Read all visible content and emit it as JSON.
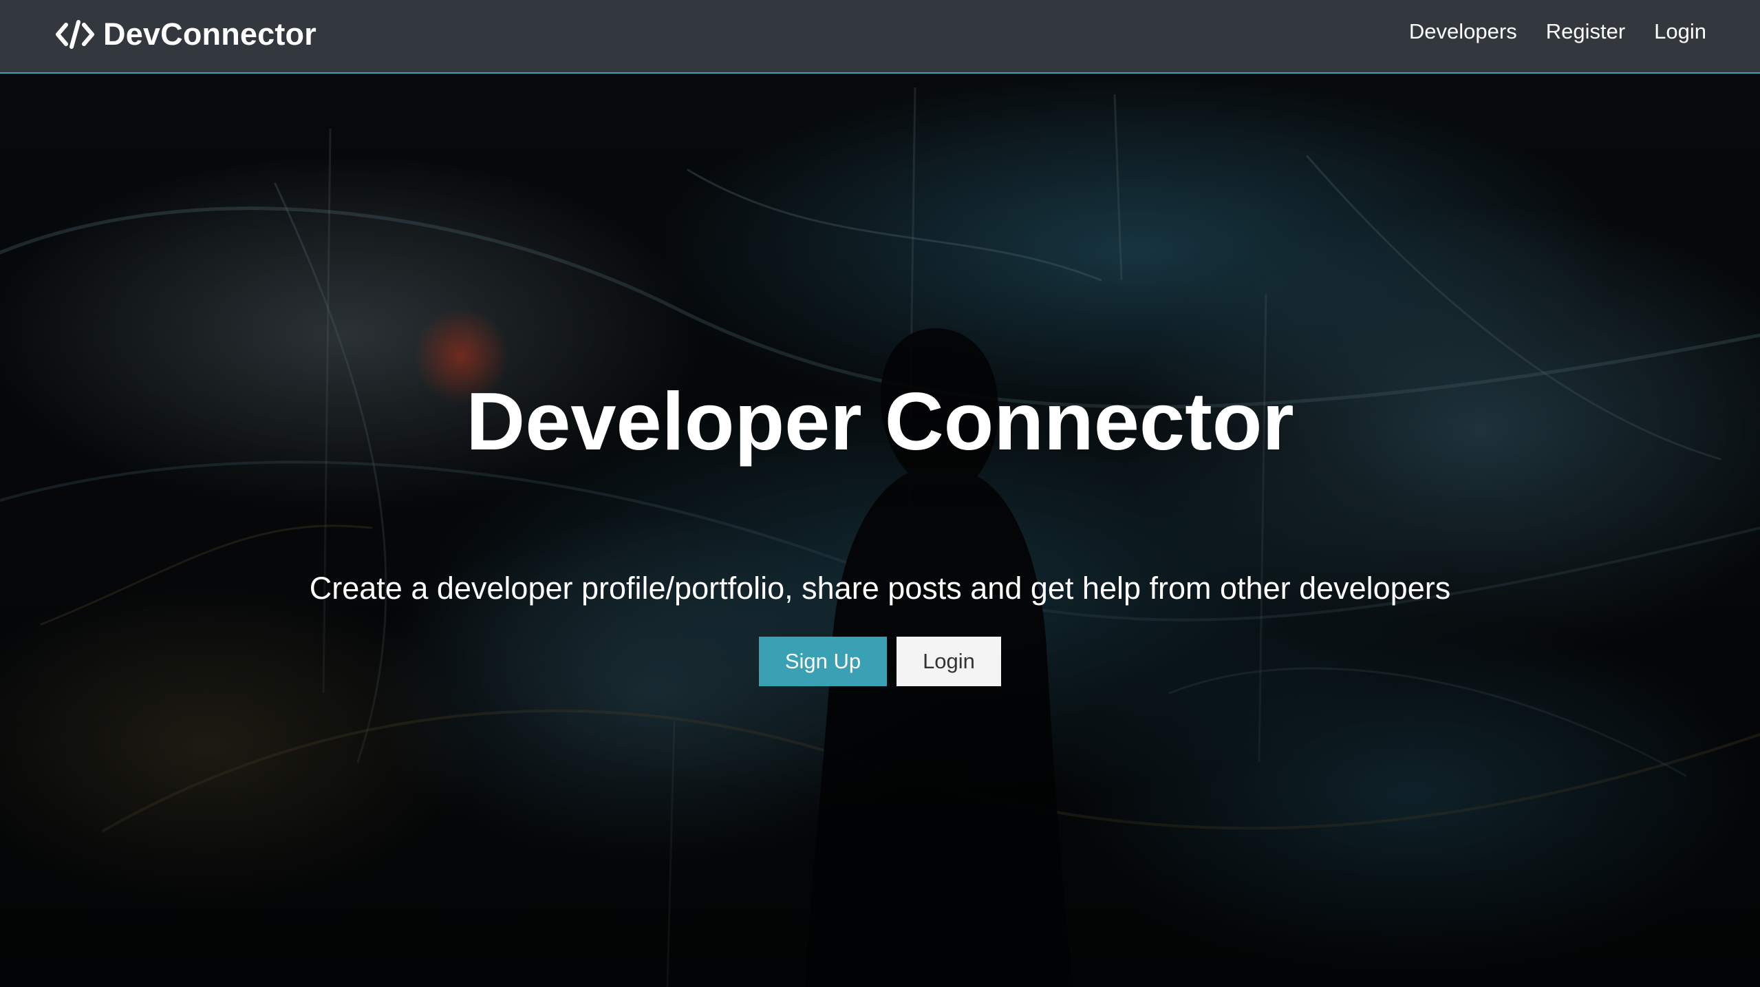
{
  "navbar": {
    "brand_icon": "code-icon",
    "brand_text": "DevConnector",
    "links": [
      {
        "label": "Developers"
      },
      {
        "label": "Register"
      },
      {
        "label": "Login"
      }
    ]
  },
  "hero": {
    "title": "Developer Connector",
    "lead": "Create a developer profile/portfolio, share posts and get help from other developers",
    "signup_label": "Sign Up",
    "login_label": "Login",
    "background_image": "dark abstract light-painting with silhouette of a person"
  },
  "colors": {
    "accent": "#3aa0b4",
    "navbar_bg": "#33373e",
    "light_button": "#f4f4f4",
    "text_light": "#ffffff"
  }
}
